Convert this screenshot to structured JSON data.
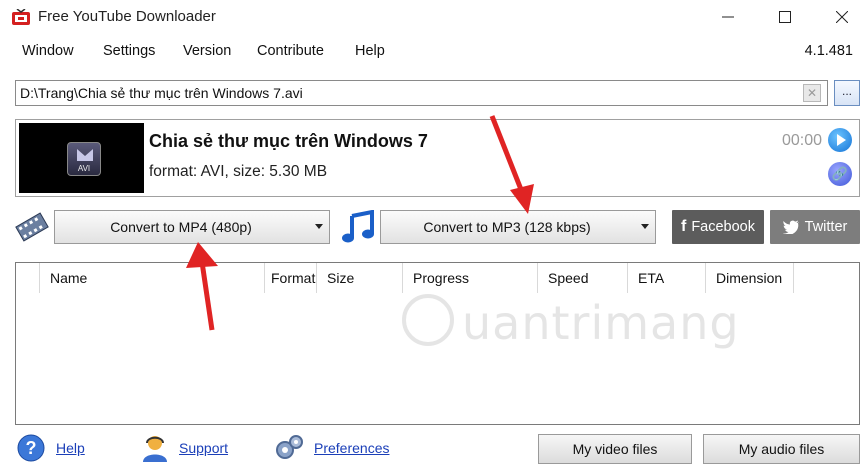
{
  "window": {
    "title": "Free YouTube Downloader",
    "min_icon": "minimize-icon",
    "max_icon": "maximize-icon",
    "close_icon": "close-icon"
  },
  "menu": {
    "items": [
      "Window",
      "Settings",
      "Version",
      "Contribute",
      "Help"
    ],
    "version": "4.1.481"
  },
  "path": {
    "value": "D:\\Trang\\Chia sẻ thư mục trên Windows 7.avi",
    "browse_label": "..."
  },
  "video": {
    "thumb_badge": "AVI",
    "title": "Chia sẻ thư mục trên Windows 7",
    "meta": "format: AVI, size: 5.30 MB",
    "time": "00:00"
  },
  "convert": {
    "video_label": "Convert to MP4 (480p)",
    "audio_label": "Convert to MP3 (128 kbps)"
  },
  "social": {
    "facebook": "Facebook",
    "twitter": "Twitter"
  },
  "table": {
    "columns": [
      "Name",
      "Format",
      "Size",
      "Progress",
      "Speed",
      "ETA",
      "Dimension"
    ]
  },
  "watermark": "uantrimang",
  "footer": {
    "help": "Help",
    "support": "Support",
    "preferences": "Preferences",
    "my_video_files": "My video files",
    "my_audio_files": "My audio files"
  },
  "colors": {
    "accent_red": "#e02424",
    "link_blue": "#1b3fb8",
    "facebook_gray": "#5c5c5c",
    "twitter_gray": "#7d7d7d"
  }
}
